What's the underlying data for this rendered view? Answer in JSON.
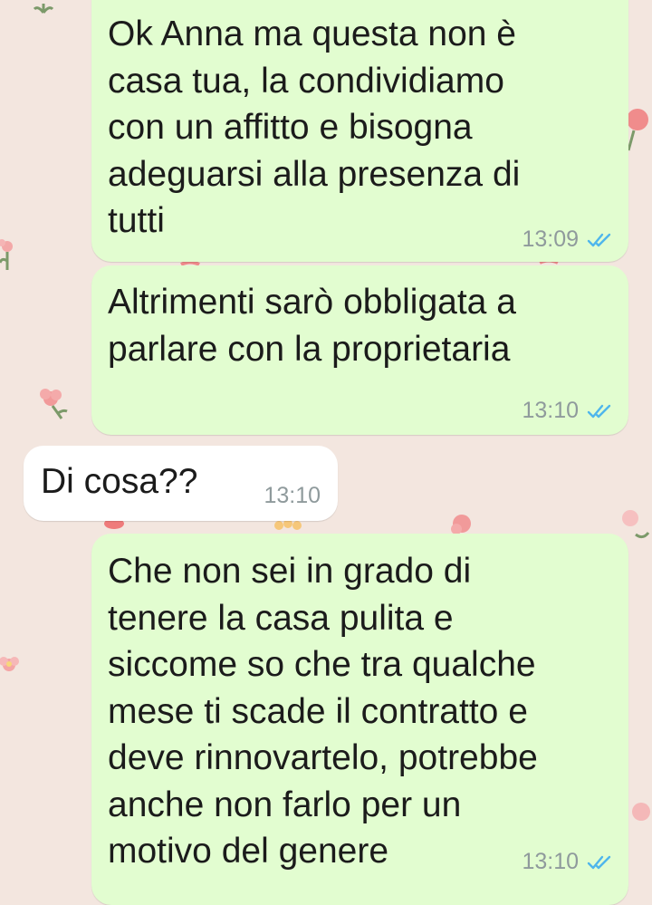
{
  "chat": {
    "messages": [
      {
        "direction": "outgoing",
        "text": "Ok Anna ma questa non è\ncasa tua, la condividiamo\ncon un affitto e bisogna\nadeguarsi alla presenza di\ntutti",
        "time": "13:09",
        "status": "read"
      },
      {
        "direction": "outgoing",
        "text": "Altrimenti sarò obbligata a\nparlare con la proprietaria",
        "time": "13:10",
        "status": "read"
      },
      {
        "direction": "incoming",
        "text": "Di cosa??",
        "time": "13:10"
      },
      {
        "direction": "outgoing",
        "text": "Che non sei in grado di\ntenere la casa pulita e\nsiccome so che tra qualche\nmese ti scade il contratto e\ndeve rinnovartelo, potrebbe\nanche non farlo per un\nmotivo del genere",
        "time": "13:10",
        "status": "read"
      }
    ]
  },
  "colors": {
    "background": "#f3e6df",
    "outgoing_bubble": "#e2fdd0",
    "incoming_bubble": "#ffffff",
    "read_ticks": "#4fb6ec",
    "timestamp": "#8f9a9c"
  },
  "icons": {
    "read_receipt": "double-check-icon",
    "wallpaper": "flower-icon"
  }
}
